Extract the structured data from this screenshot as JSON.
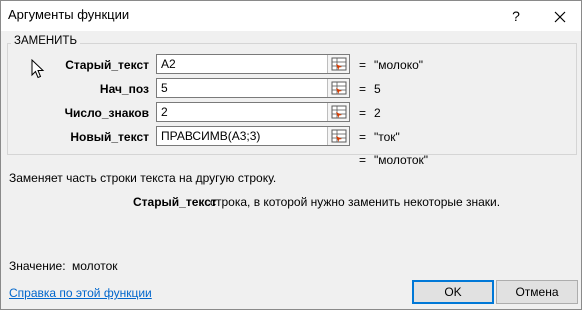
{
  "window": {
    "title": "Аргументы функции",
    "help_glyph": "?",
    "close_label": "close"
  },
  "group": {
    "label": "ЗАМЕНИТЬ",
    "args": [
      {
        "label": "Старый_текст",
        "value": "A2",
        "result": "\"молоко\""
      },
      {
        "label": "Нач_поз",
        "value": "5",
        "result": "5"
      },
      {
        "label": "Число_знаков",
        "value": "2",
        "result": "2"
      },
      {
        "label": "Новый_текст",
        "value": "ПРАВСИМВ(A3;3)",
        "result": "\"ток\""
      }
    ],
    "eq": "="
  },
  "formula_result": "\"молоток\"",
  "description": "Заменяет часть строки текста на другую строку.",
  "arg_help": {
    "name": "Старый_текст",
    "text": "строка, в которой нужно заменить некоторые знаки."
  },
  "value": {
    "label": "Значение:",
    "text": "молоток"
  },
  "footer": {
    "help_link": "Справка по этой функции",
    "ok": "OK",
    "cancel": "Отмена"
  }
}
